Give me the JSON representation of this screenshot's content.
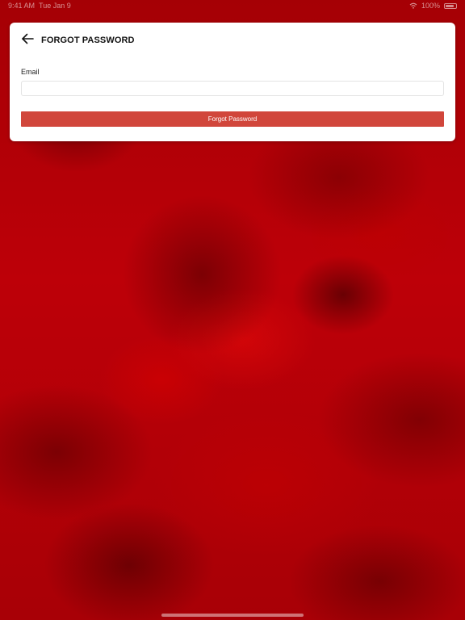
{
  "status_bar": {
    "time": "9:41 AM",
    "date": "Tue Jan 9",
    "battery": "100%"
  },
  "header": {
    "title": "FORGOT PASSWORD",
    "back_icon": "arrow-left-icon"
  },
  "form": {
    "email_label": "Email",
    "email_value": "",
    "email_placeholder": "",
    "submit_label": "Forgot Password"
  },
  "colors": {
    "background": "#b00006",
    "button": "#d1463b",
    "card": "#ffffff"
  }
}
